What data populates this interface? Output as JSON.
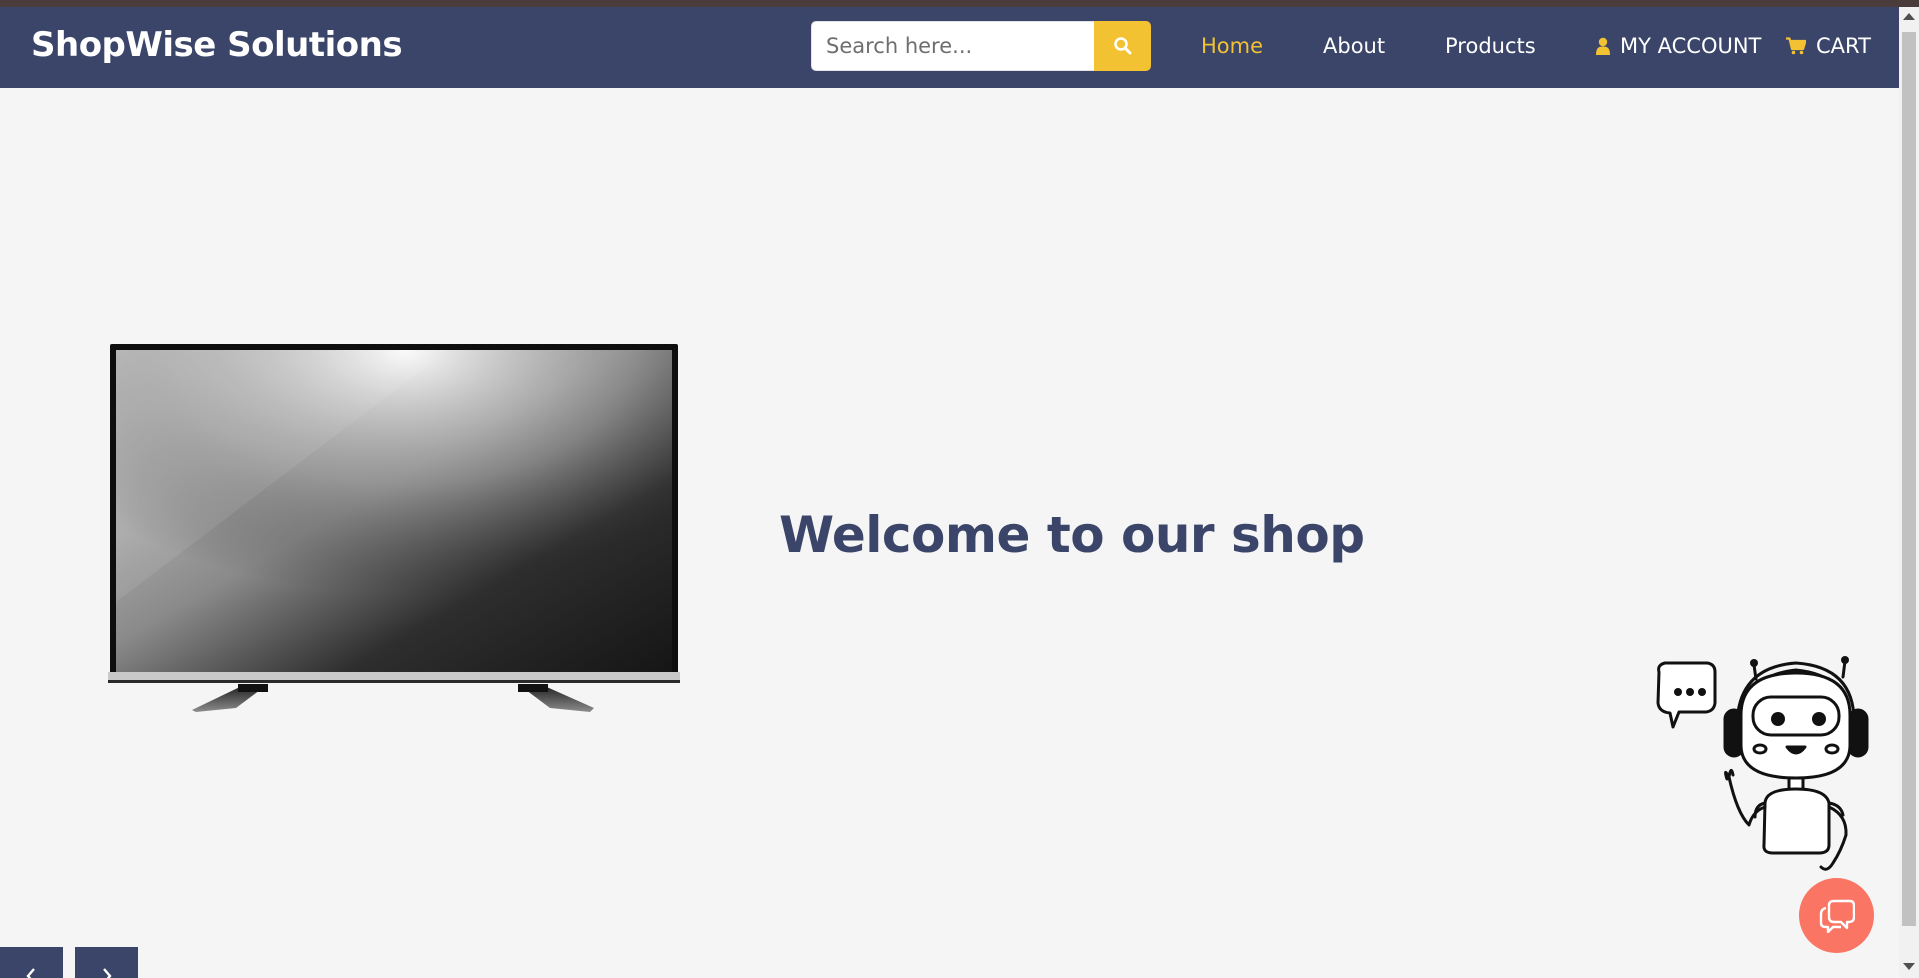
{
  "header": {
    "brand": "ShopWise Solutions",
    "search": {
      "placeholder": "Search here...",
      "value": "",
      "button_icon": "search-icon"
    },
    "nav": [
      {
        "label": "Home",
        "active": true
      },
      {
        "label": "About",
        "active": false
      },
      {
        "label": "Products",
        "active": false
      },
      {
        "label": "MY ACCOUNT",
        "icon": "user-icon"
      },
      {
        "label": "CART",
        "icon": "cart-icon"
      }
    ]
  },
  "hero": {
    "image": "television-image",
    "heading": "Welcome to our shop"
  },
  "assistant": {
    "illustration": "robot-assistant-illustration",
    "chat_button_icon": "chat-bubble-icon"
  },
  "slider": {
    "prev_icon": "chevron-left-icon",
    "next_icon": "chevron-right-icon"
  },
  "colors": {
    "navbar": "#3a4569",
    "accent": "#f2c232",
    "heading": "#3a4569",
    "chat_button": "#fa7563",
    "background": "#f5f5f5"
  }
}
